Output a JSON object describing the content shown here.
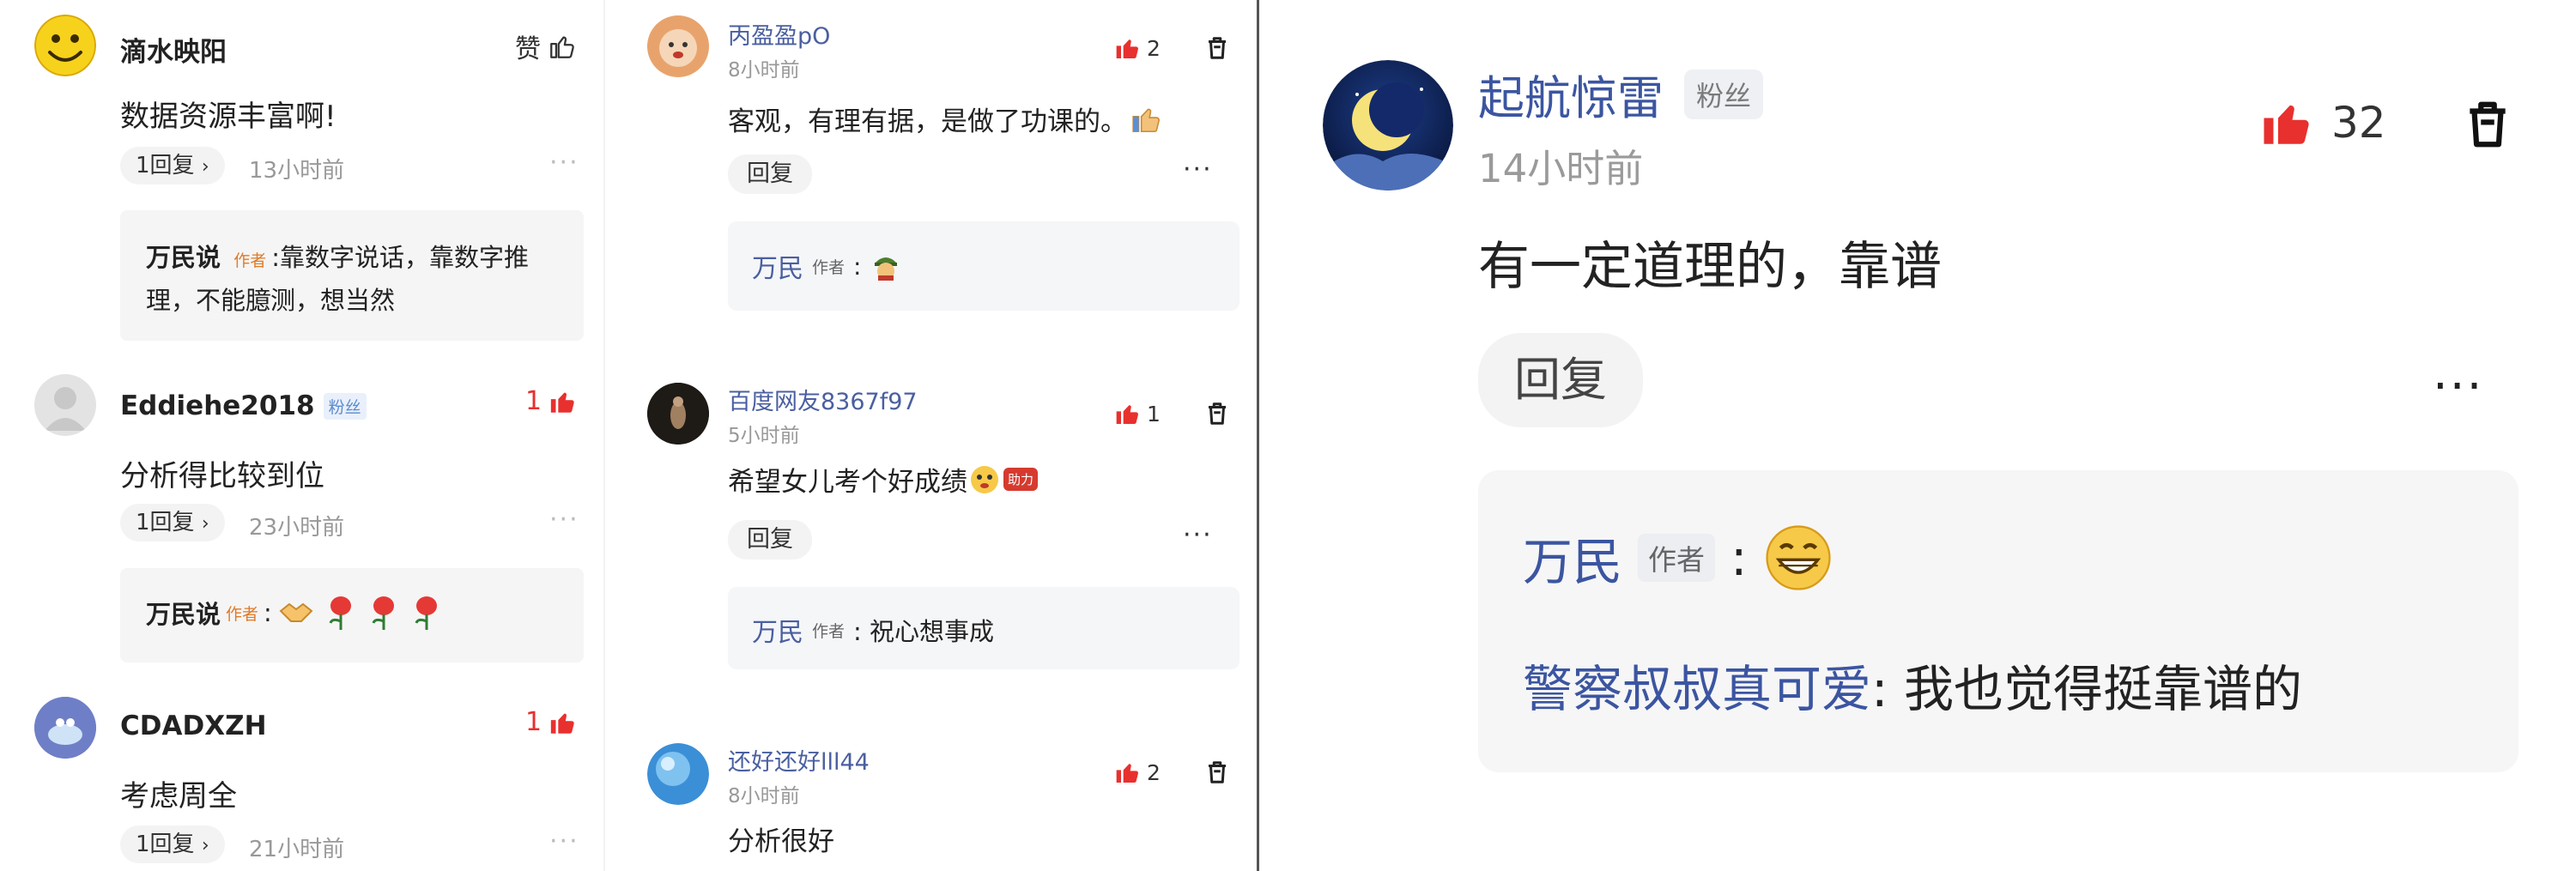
{
  "panel1": {
    "comments": [
      {
        "user": "滴水映阳",
        "like_label": "赞",
        "text": "数据资源丰富啊!",
        "reply_label": "1回复",
        "time": "13小时前",
        "sub": {
          "name": "万民说",
          "author_badge": "作者",
          "text": ":靠数字说话，靠数字推理，不能臆测，想当然"
        }
      },
      {
        "user": "Eddiehe2018",
        "fan_badge": "粉丝",
        "likes": "1",
        "text": "分析得比较到位",
        "reply_label": "1回复",
        "time": "23小时前",
        "sub": {
          "name": "万民说",
          "author_badge": "作者",
          "text": ":"
        }
      },
      {
        "user": "CDADXZH",
        "likes": "1",
        "text": "考虑周全",
        "reply_label": "1回复",
        "time": "21小时前"
      }
    ]
  },
  "panel2": {
    "comments": [
      {
        "user": "丙盈盈pO",
        "time": "8小时前",
        "likes": "2",
        "text": "客观，有理有据，是做了功课的。",
        "reply_label": "回复",
        "sub": {
          "name": "万民",
          "author_badge": "作者",
          "text": ":"
        }
      },
      {
        "user": "百度网友8367f97",
        "time": "5小时前",
        "likes": "1",
        "text": "希望女儿考个好成绩",
        "sticker_text": "助力",
        "reply_label": "回复",
        "sub": {
          "name": "万民",
          "author_badge": "作者",
          "text": ":  祝心想事成"
        }
      },
      {
        "user": "还好还好lll44",
        "time": "8小时前",
        "likes": "2",
        "text": "分析很好"
      }
    ]
  },
  "panel3": {
    "user": "起航惊雷",
    "fan_badge": "粉丝",
    "time": "14小时前",
    "likes": "32",
    "text": "有一定道理的，靠谱",
    "reply_label": "回复",
    "sub": {
      "name": "万民",
      "author_badge": "作者",
      "colon": ":",
      "reply_user": "警察叔叔真可爱",
      "reply_text": ":  我也觉得挺靠谱的"
    }
  },
  "colors": {
    "like_red": "#e8302e",
    "link_blue": "#3b55a0",
    "author_orange": "#e07a28"
  }
}
